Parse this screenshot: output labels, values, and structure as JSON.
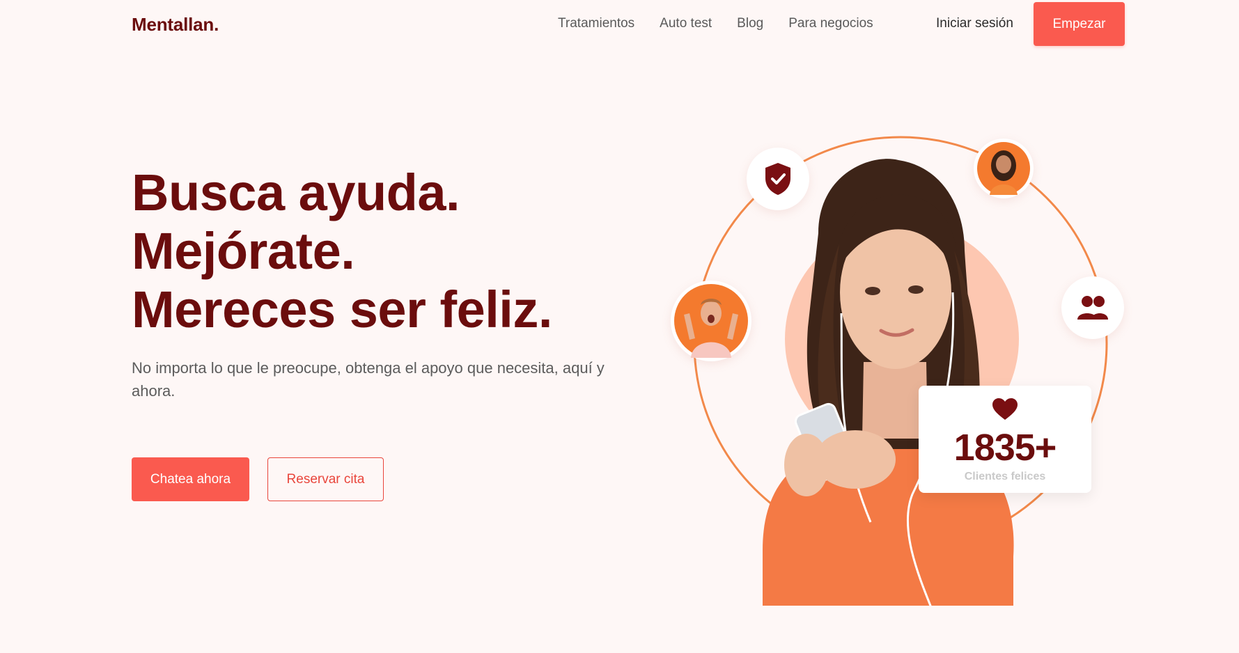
{
  "brand": {
    "logo": "Mentallan."
  },
  "nav": {
    "links": [
      "Tratamientos",
      "Auto test",
      "Blog",
      "Para negocios"
    ],
    "login": "Iniciar sesión",
    "cta": "Empezar"
  },
  "hero": {
    "headline": [
      "Busca ayuda.",
      "Mejórate.",
      "Mereces ser feliz."
    ],
    "subtitle": "No importa lo que le preocupe, obtenga el apoyo que necesita, aquí y ahora.",
    "primary_button": "Chatea ahora",
    "secondary_button": "Reservar cita"
  },
  "stats": {
    "value": "1835+",
    "label": "Clientes felices"
  },
  "icons": [
    "shield-check-icon",
    "users-icon",
    "heart-icon"
  ],
  "colors": {
    "accent": "#fa5a4f",
    "brand_dark": "#6b0d0d",
    "ring": "#f2894a",
    "background": "#fef7f6"
  }
}
